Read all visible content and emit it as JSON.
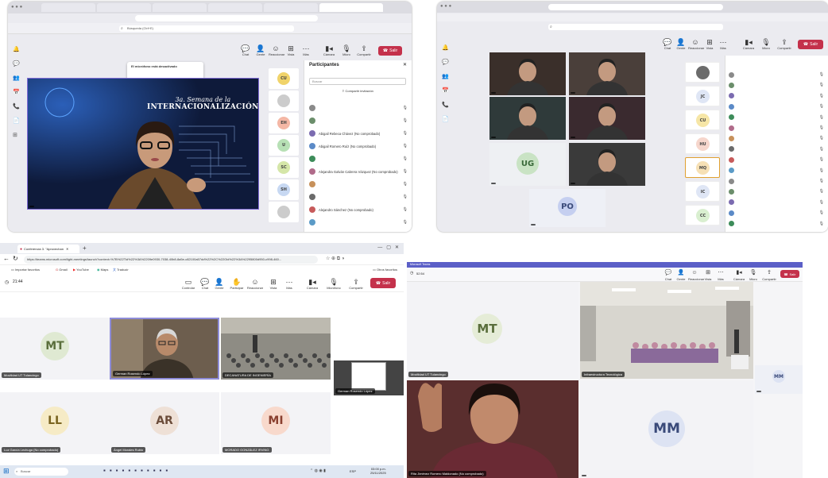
{
  "pane1": {
    "tabs": [
      "",
      "",
      "",
      "",
      "",
      ""
    ],
    "address": "",
    "search": "Búsqueda (Ctrl+E)",
    "meeting_bar": "",
    "timer": "",
    "toolbar": [
      "Chat",
      "Gente",
      "Reaccionar",
      "Vista",
      "Más",
      "Cámara",
      "Micro",
      "Compartir",
      "Salir"
    ],
    "toast_title": "El micrófono está desactivado",
    "toast_body": "",
    "slide_title_top": "3a. Semana de la",
    "slide_title_mid": "INTERNACIONALIZACIÓN",
    "slide_tag": "",
    "presenter_label": "",
    "side_avatars": [
      {
        "initials": "CU",
        "color": "#f0d36a"
      },
      {
        "initials": "",
        "color": "#cccccc"
      },
      {
        "initials": "EH",
        "color": "#f4b7a5"
      },
      {
        "initials": "U",
        "color": "#b7e0b5"
      },
      {
        "initials": "SC",
        "color": "#d5e6a8"
      },
      {
        "initials": "SH",
        "color": "#c7d8f2"
      },
      {
        "initials": "",
        "color": "#cccccc"
      }
    ],
    "people_title": "Participantes",
    "people_search": "Buscar",
    "people_share": "Compartir invitación",
    "people_section": "",
    "people": [
      {
        "name": "",
        "color": "#8a8a8a"
      },
      {
        "name": "",
        "color": "#6b8e6b"
      },
      {
        "name": "Abigail Rebeca Chávez (No comprobado)",
        "color": "#7b6bb0"
      },
      {
        "name": "Abigail Romero Ruíz (No comprobado)",
        "color": "#5b8ac7"
      },
      {
        "name": "",
        "color": "#3d8c5a"
      },
      {
        "name": "Alejandra Galván Cabrera Vázquez (No comprobado)",
        "color": "#b06b8a"
      },
      {
        "name": "",
        "color": "#c7915b"
      },
      {
        "name": "",
        "color": "#6b6b6b"
      },
      {
        "name": "Alejandro Sánchez (No comprobado)",
        "color": "#c75b5b"
      },
      {
        "name": "",
        "color": "#5b9bc7"
      }
    ]
  },
  "pane2": {
    "address": "",
    "title": "",
    "search": "",
    "toolbar": [
      "Chat",
      "Gente",
      "Reaccionar",
      "Vista",
      "Más",
      "Cámara",
      "Micro",
      "Compartir",
      "Salir"
    ],
    "tiles": [
      {
        "label": "",
        "initials": "",
        "color": "#3a2f2a"
      },
      {
        "label": "",
        "initials": "",
        "color": "#4a3f3a"
      },
      {
        "label": "",
        "initials": "",
        "color": "#2f3a3a"
      },
      {
        "label": "",
        "initials": "",
        "color": "#3a2a2f"
      },
      {
        "label": "",
        "initials": "UG",
        "color": "#c9e3c4"
      },
      {
        "label": "",
        "initials": "",
        "color": "#3a3a3a"
      }
    ],
    "po": {
      "label": "",
      "initials": "PO",
      "color": "#c5cff0"
    },
    "strip": [
      {
        "initials": "",
        "color": "#6b6b6b"
      },
      {
        "initials": "JC",
        "color": "#dfe6f5"
      },
      {
        "initials": "CU",
        "color": "#f6e6a6"
      },
      {
        "initials": "HU",
        "color": "#f6d6cc"
      },
      {
        "initials": "MQ",
        "color": "#f6e0b5"
      },
      {
        "initials": "IC",
        "color": "#dfe6f5"
      },
      {
        "initials": "CC",
        "color": "#d9efd0"
      }
    ],
    "people_title": "",
    "people": [
      {
        "name": "",
        "color": "#8a8a8a"
      },
      {
        "name": "",
        "color": "#6b8e6b"
      },
      {
        "name": "",
        "color": "#7b6bb0"
      },
      {
        "name": "",
        "color": "#5b8ac7"
      },
      {
        "name": "",
        "color": "#3d8c5a"
      },
      {
        "name": "",
        "color": "#b06b8a"
      },
      {
        "name": "",
        "color": "#c7915b"
      },
      {
        "name": "",
        "color": "#6b6b6b"
      },
      {
        "name": "",
        "color": "#c75b5b"
      },
      {
        "name": "",
        "color": "#5b9bc7"
      },
      {
        "name": "",
        "color": "#8a8a8a"
      },
      {
        "name": "",
        "color": "#6b8e6b"
      },
      {
        "name": "",
        "color": "#7b6bb0"
      },
      {
        "name": "",
        "color": "#5b8ac7"
      },
      {
        "name": "",
        "color": "#3d8c5a"
      }
    ]
  },
  "pane3": {
    "tab_title": "Conferencia 3. \"Aprovechan",
    "url": "https://teams.microsoft.com/light-meetings/launch?context=%7B%22Tid%22%3A%2209e0930-7038-40b8-8a5e-c82100a57dd%22%2C%22Oid%22%3A%2295800d950-c998-460...",
    "bookmarks": [
      "Importar favoritos",
      "Gmail",
      "YouTube",
      "Maps",
      "Traducir"
    ],
    "bookmarks_right": "Otros favoritos",
    "timer": "21:44",
    "toolbar": [
      "Controlar",
      "Chat",
      "Gente",
      "Participar",
      "Reaccionar",
      "Vista",
      "Más",
      "Cámara",
      "Micrófono",
      "Compartir"
    ],
    "leave": "Salir",
    "tiles": [
      {
        "label": "Movilidad UT Tulancingo",
        "initials": "MT",
        "color": "#dfe9d2",
        "fg": "#5a6e3c"
      },
      {
        "label": "German Rosendo López",
        "initials": "",
        "color": "#6b5a48",
        "fg": "#fff"
      },
      {
        "label": "DECANATURA DE INGENIERÍA",
        "initials": "",
        "color": "#8a8a80",
        "fg": "#fff"
      },
      {
        "label": "Luz García Lechuga (No comprobado)",
        "initials": "LL",
        "color": "#f6ebc6",
        "fg": "#7a6420"
      },
      {
        "label": "Ángel Morales Rubio",
        "initials": "AR",
        "color": "#eee0d6",
        "fg": "#6b4c3a"
      },
      {
        "label": "MORADO GONZÁLEZ IRVING",
        "initials": "MI",
        "color": "#f8d9cc",
        "fg": "#8a4030"
      }
    ],
    "share_label": "German Rosendo López",
    "taskbar_search": "Buscar",
    "taskbar_time": "03:00 p.m.",
    "taskbar_date": "25/11/2025",
    "taskbar_lang": "ESP"
  },
  "pane4": {
    "title": "Microsoft Teams",
    "timer": "52:54",
    "toolbar": [
      "Chat",
      "Gente",
      "Reaccionar",
      "Vista",
      "Más",
      "Cámara",
      "Micro",
      "Compartir"
    ],
    "leave": "Salir",
    "tiles": [
      {
        "label": "Movilidad UT Tulancingo",
        "initials": "MT",
        "color": "#e5ecd7",
        "fg": "#5a6e3c"
      },
      {
        "label": "Infraestructura Tecnológica",
        "initials": "",
        "color": "#c8c5bc",
        "fg": "#fff"
      },
      {
        "label": "Rita Jiménez Romero Maldonado (No comprobado)",
        "initials": "",
        "color": "#5a2a2a",
        "fg": "#fff"
      },
      {
        "label": "",
        "initials": "MM",
        "color": "#dde3f3",
        "fg": "#3a4a7a"
      }
    ],
    "mini": {
      "initials": "MM",
      "color": "#dde3f3",
      "label": ""
    }
  }
}
